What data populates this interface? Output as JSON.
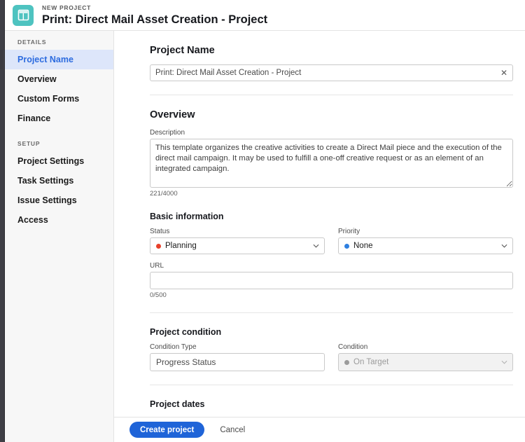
{
  "header": {
    "eyebrow": "NEW PROJECT",
    "title": "Print: Direct Mail Asset Creation - Project",
    "app_icon": "project-template-icon",
    "icon_color": "#4ec3c0"
  },
  "sidebar": {
    "sections": [
      {
        "label": "DETAILS",
        "items": [
          {
            "label": "Project Name",
            "active": true
          },
          {
            "label": "Overview",
            "active": false
          },
          {
            "label": "Custom Forms",
            "active": false
          },
          {
            "label": "Finance",
            "active": false
          }
        ]
      },
      {
        "label": "SETUP",
        "items": [
          {
            "label": "Project Settings",
            "active": false
          },
          {
            "label": "Task Settings",
            "active": false
          },
          {
            "label": "Issue Settings",
            "active": false
          },
          {
            "label": "Access",
            "active": false
          }
        ]
      }
    ],
    "active_color": "#2d6cdf",
    "active_bg": "#dde6fa"
  },
  "main": {
    "project_name": {
      "heading": "Project Name",
      "value": "Print: Direct Mail Asset Creation - Project",
      "placeholder": "Project Name",
      "clear_icon": "close-icon"
    },
    "overview": {
      "heading": "Overview",
      "description_label": "Description",
      "description_value": "This template organizes the creative activities to create a Direct Mail piece and the execution of the direct mail campaign. It may be used to fulfill a one-off creative request or as an element of an integrated campaign.",
      "description_placeholder": "Description",
      "description_counter": "221/4000"
    },
    "basic_information": {
      "heading": "Basic information",
      "status_label": "Status",
      "status_value": "Planning",
      "status_dot_color": "#e8402a",
      "priority_label": "Priority",
      "priority_value": "None",
      "priority_dot_color": "#2e7fe0",
      "url_label": "URL",
      "url_value": "",
      "url_placeholder": "",
      "url_counter": "0/500"
    },
    "project_condition": {
      "heading": "Project condition",
      "condition_type_label": "Condition Type",
      "condition_type_value": "Progress Status",
      "condition_label": "Condition",
      "condition_value": "On Target",
      "condition_dot_color": "#9b9b9b"
    },
    "project_dates": {
      "heading": "Project dates"
    }
  },
  "footer": {
    "create_label": "Create project",
    "cancel_label": "Cancel",
    "primary_color": "#1f64d8"
  }
}
